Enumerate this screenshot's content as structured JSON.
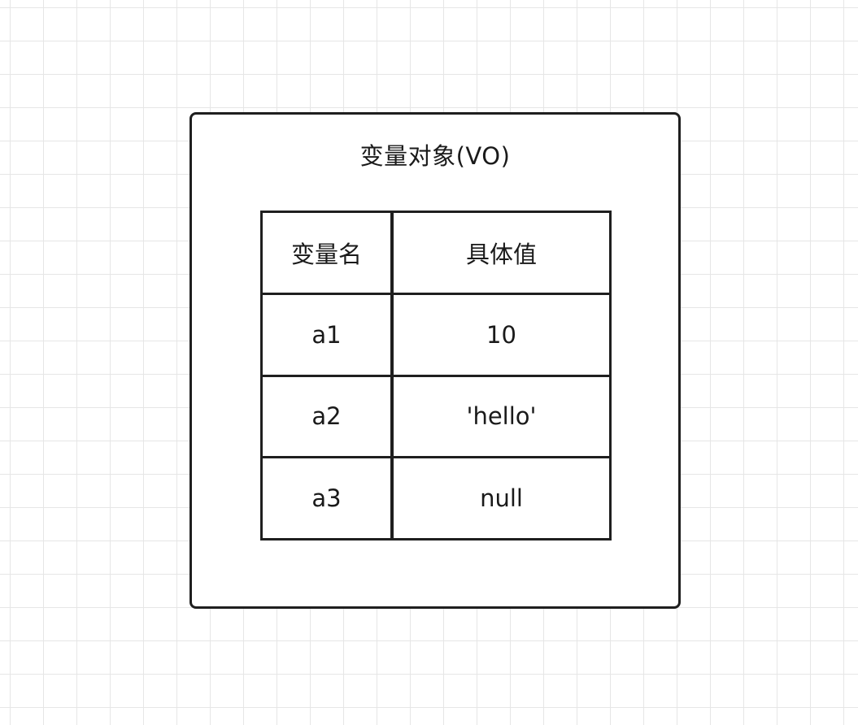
{
  "diagram": {
    "title": "变量对象(VO)",
    "table": {
      "header": {
        "name": "变量名",
        "value": "具体值"
      },
      "rows": [
        {
          "name": "a1",
          "value": "10"
        },
        {
          "name": "a2",
          "value": "'hello'"
        },
        {
          "name": "a3",
          "value": "null"
        }
      ]
    }
  }
}
